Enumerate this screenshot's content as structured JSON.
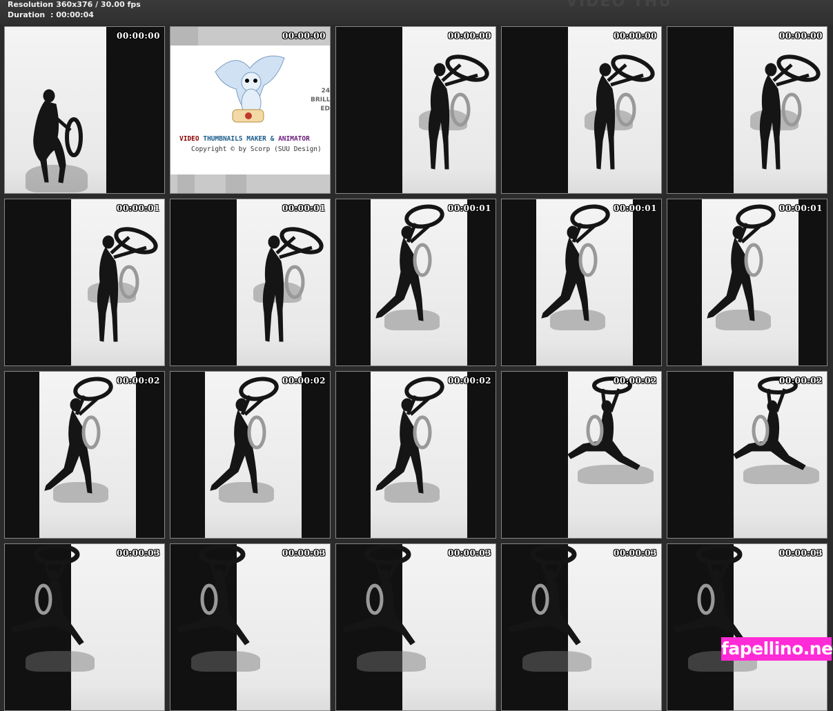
{
  "header": {
    "resolution_label": "Resolution",
    "resolution_value": "360x376 / 30.00 fps",
    "duration_label": "Duration",
    "duration_value": "00:00:04",
    "watermark": "VIDEO THU"
  },
  "promo": {
    "video": "VIDEO",
    "thumbnails": "THUMBNAILS MAKER",
    "amp": "&",
    "animator": "ANIMATOR",
    "copyright": "Copyright © by Scorp (SUU Design)",
    "side_text": [
      "24",
      "BRILL",
      "ED"
    ]
  },
  "frames": [
    {
      "ts": "00:00:00",
      "variant": "a"
    },
    {
      "ts": "00:00:00",
      "variant": "promo"
    },
    {
      "ts": "00:00:00",
      "variant": "b"
    },
    {
      "ts": "00:00:00",
      "variant": "b"
    },
    {
      "ts": "00:00:00",
      "variant": "b"
    },
    {
      "ts": "00:00:01",
      "variant": "b"
    },
    {
      "ts": "00:00:01",
      "variant": "b"
    },
    {
      "ts": "00:00:01",
      "variant": "c"
    },
    {
      "ts": "00:00:01",
      "variant": "c"
    },
    {
      "ts": "00:00:01",
      "variant": "c"
    },
    {
      "ts": "00:00:02",
      "variant": "c"
    },
    {
      "ts": "00:00:02",
      "variant": "c"
    },
    {
      "ts": "00:00:02",
      "variant": "c"
    },
    {
      "ts": "00:00:02",
      "variant": "d"
    },
    {
      "ts": "00:00:02",
      "variant": "d"
    },
    {
      "ts": "00:00:03",
      "variant": "e"
    },
    {
      "ts": "00:00:03",
      "variant": "e"
    },
    {
      "ts": "00:00:03",
      "variant": "e"
    },
    {
      "ts": "00:00:03",
      "variant": "e"
    },
    {
      "ts": "00:00:03",
      "variant": "e"
    }
  ],
  "badge": {
    "text": "fapellino.net",
    "color": "#ff2bd6"
  }
}
